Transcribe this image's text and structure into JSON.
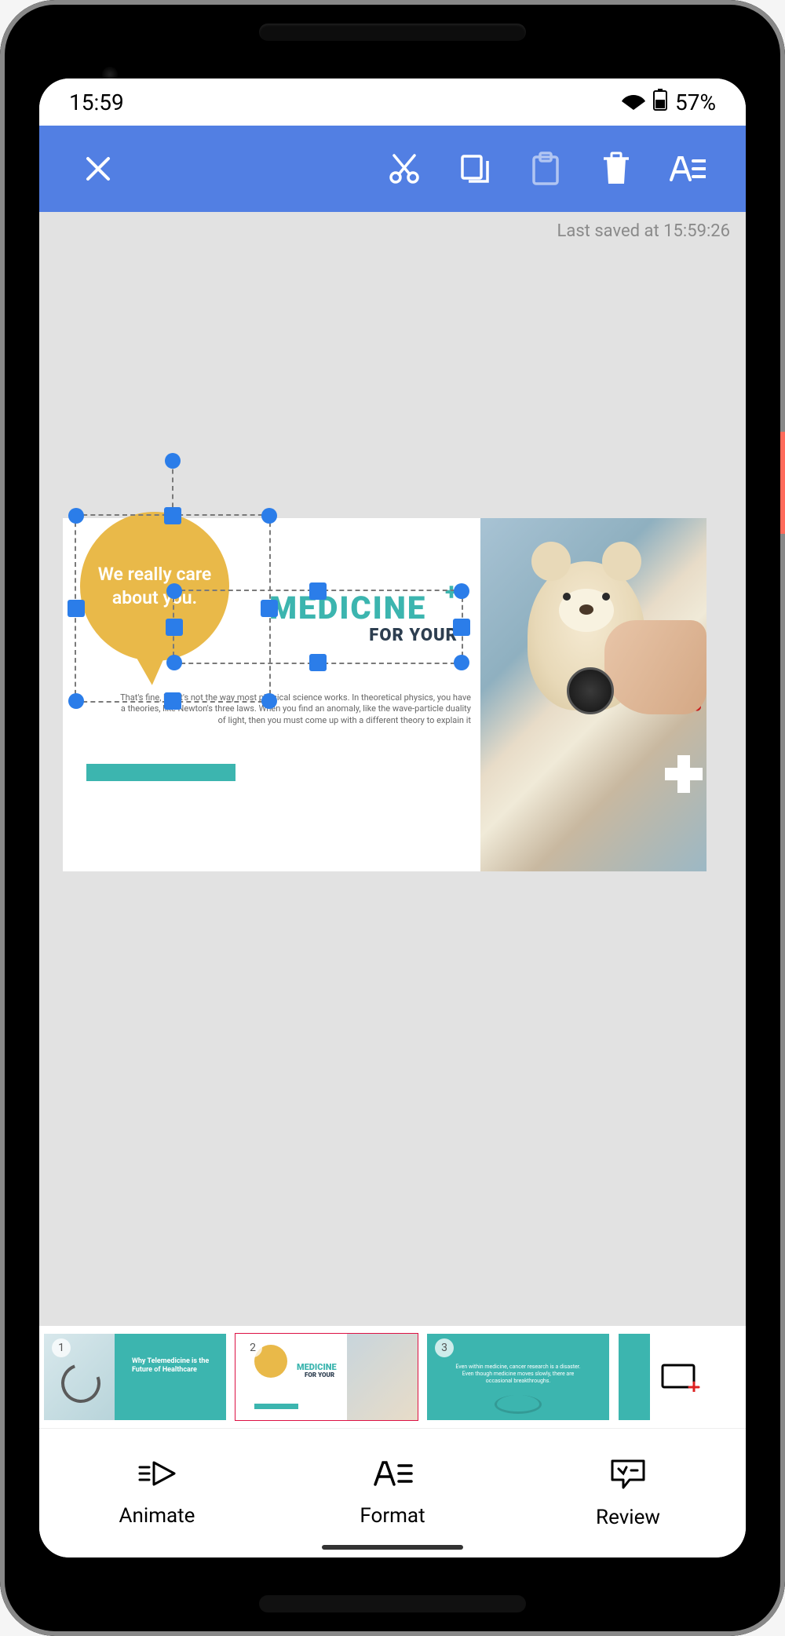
{
  "status": {
    "time": "15:59",
    "battery": "57%"
  },
  "lastSaved": "Last saved at 15:59:26",
  "slide": {
    "bubble": "We really care about you.",
    "headlineMain": "MEDICINE",
    "headlineSub": "FOR YOUR",
    "body": "That's fine, but it's not the way most physical science works. In theoretical physics, you have a theories, like Newton's three laws. When you find an anomaly, like the wave-particle duality of light, then you must come up with a different theory to explain it"
  },
  "thumbs": {
    "t1": {
      "num": "1",
      "title": "Why Telemedicine is the Future of Healthcare"
    },
    "t2": {
      "num": "2",
      "headlineMain": "MEDICINE",
      "headlineSub": "FOR YOUR"
    },
    "t3": {
      "num": "3",
      "text": "Even within medicine, cancer research is a disaster. Even though medicine moves slowly, there are occasional breakthroughs."
    }
  },
  "nav": {
    "animate": "Animate",
    "format": "Format",
    "review": "Review"
  }
}
